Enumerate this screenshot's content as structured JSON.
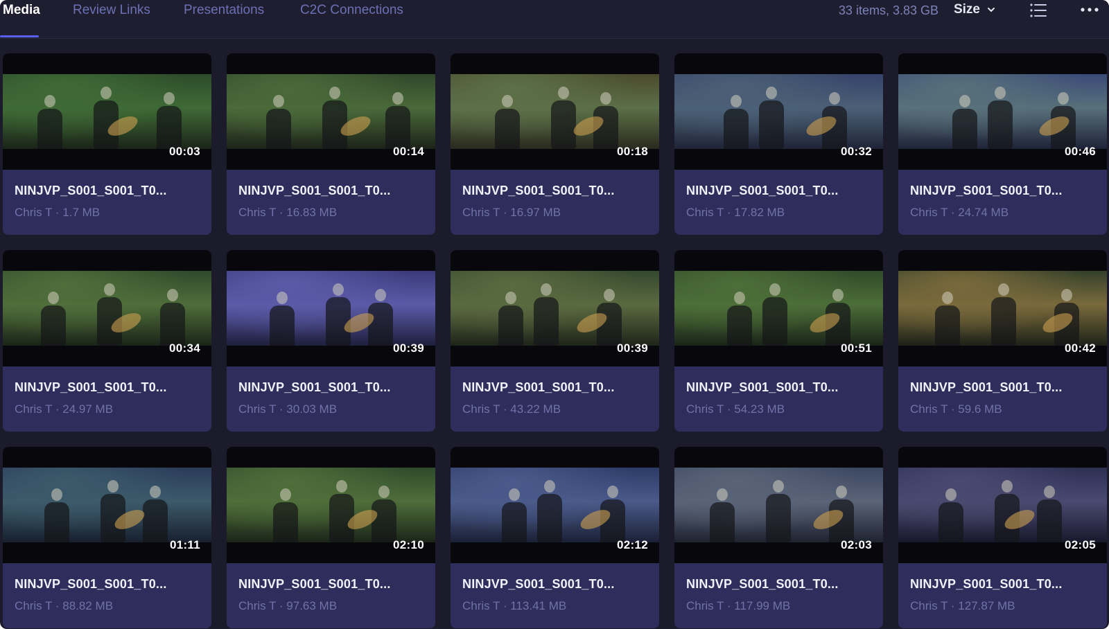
{
  "tabs": [
    {
      "label": "Media",
      "active": true
    },
    {
      "label": "Review Links",
      "active": false
    },
    {
      "label": "Presentations",
      "active": false
    },
    {
      "label": "C2C Connections",
      "active": false
    }
  ],
  "toolbar": {
    "item_count": "33 items, 3.83 GB",
    "sort_label": "Size",
    "list_view_icon": "list-icon",
    "more_icon": "ellipsis-icon"
  },
  "colors": {
    "background": "#1c1b2c",
    "card_info": "#2f2d5c",
    "accent": "#5b5ff0",
    "inactive_tab": "#6c71b6"
  },
  "media": [
    {
      "name": "NINJVP_S001_S001_T0...",
      "owner": "Chris T",
      "size": "1.7 MB",
      "duration": "00:03",
      "tint": [
        "#2c4a2a",
        "#3f6a36",
        "#1a2418"
      ]
    },
    {
      "name": "NINJVP_S001_S001_T0...",
      "owner": "Chris T",
      "size": "16.83 MB",
      "duration": "00:14",
      "tint": [
        "#30472b",
        "#4a6a3a",
        "#1c2218"
      ]
    },
    {
      "name": "NINJVP_S001_S001_T0...",
      "owner": "Chris T",
      "size": "16.97 MB",
      "duration": "00:18",
      "tint": [
        "#4a4a2c",
        "#5c7048",
        "#2a2a1e"
      ]
    },
    {
      "name": "NINJVP_S001_S001_T0...",
      "owner": "Chris T",
      "size": "17.82 MB",
      "duration": "00:32",
      "tint": [
        "#35426a",
        "#4b6076",
        "#1f2436"
      ]
    },
    {
      "name": "NINJVP_S001_S001_T0...",
      "owner": "Chris T",
      "size": "24.74 MB",
      "duration": "00:46",
      "tint": [
        "#3a4a78",
        "#58707a",
        "#1e2338"
      ]
    },
    {
      "name": "NINJVP_S001_S001_T0...",
      "owner": "Chris T",
      "size": "24.97 MB",
      "duration": "00:34",
      "tint": [
        "#2e4a2c",
        "#4f6e3a",
        "#1a2418"
      ]
    },
    {
      "name": "NINJVP_S001_S001_T0...",
      "owner": "Chris T",
      "size": "30.03 MB",
      "duration": "00:39",
      "tint": [
        "#3a3a7a",
        "#5a5aa8",
        "#1f1f3c"
      ]
    },
    {
      "name": "NINJVP_S001_S001_T0...",
      "owner": "Chris T",
      "size": "43.22 MB",
      "duration": "00:39",
      "tint": [
        "#34482e",
        "#5a6a40",
        "#1e2419"
      ]
    },
    {
      "name": "NINJVP_S001_S001_T0...",
      "owner": "Chris T",
      "size": "54.23 MB",
      "duration": "00:51",
      "tint": [
        "#2f4a2a",
        "#4c6e38",
        "#1a2418"
      ]
    },
    {
      "name": "NINJVP_S001_S001_T0...",
      "owner": "Chris T",
      "size": "59.6 MB",
      "duration": "00:42",
      "tint": [
        "#33402a",
        "#7a6a3c",
        "#1d2218"
      ]
    },
    {
      "name": "NINJVP_S001_S001_T0...",
      "owner": "Chris T",
      "size": "88.82 MB",
      "duration": "01:11",
      "tint": [
        "#2a3a5a",
        "#3c5a6a",
        "#18202e"
      ]
    },
    {
      "name": "NINJVP_S001_S001_T0...",
      "owner": "Chris T",
      "size": "97.63 MB",
      "duration": "02:10",
      "tint": [
        "#2e4a2c",
        "#4f6e3a",
        "#1a2418"
      ]
    },
    {
      "name": "NINJVP_S001_S001_T0...",
      "owner": "Chris T",
      "size": "113.41 MB",
      "duration": "02:12",
      "tint": [
        "#2c3a66",
        "#4a5a8a",
        "#1a2034"
      ]
    },
    {
      "name": "NINJVP_S001_S001_T0...",
      "owner": "Chris T",
      "size": "117.99 MB",
      "duration": "02:03",
      "tint": [
        "#3a4660",
        "#5a6478",
        "#1e2230"
      ]
    },
    {
      "name": "NINJVP_S001_S001_T0...",
      "owner": "Chris T",
      "size": "127.87 MB",
      "duration": "02:05",
      "tint": [
        "#2c2e52",
        "#4a4a70",
        "#18182c"
      ]
    }
  ]
}
